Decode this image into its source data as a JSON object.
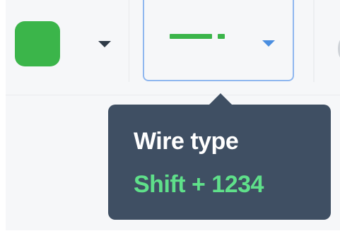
{
  "colors": {
    "wire_color": "#3bb54a",
    "tooltip_bg": "#3f4f63",
    "shortcut_text": "#5fe08a",
    "dropdown_border": "#8fb7ef",
    "caret_active": "#4a8ee0",
    "caret_default": "#2e3a47"
  },
  "toolbar": {
    "color_picker": {
      "swatch_color": "#3bb54a",
      "caret_icon": "caret-down-icon"
    },
    "wire_type_dropdown": {
      "icon": "dashed-wire-icon",
      "caret_icon": "caret-down-icon"
    }
  },
  "tooltip": {
    "title": "Wire type",
    "shortcut": "Shift + 1234"
  }
}
